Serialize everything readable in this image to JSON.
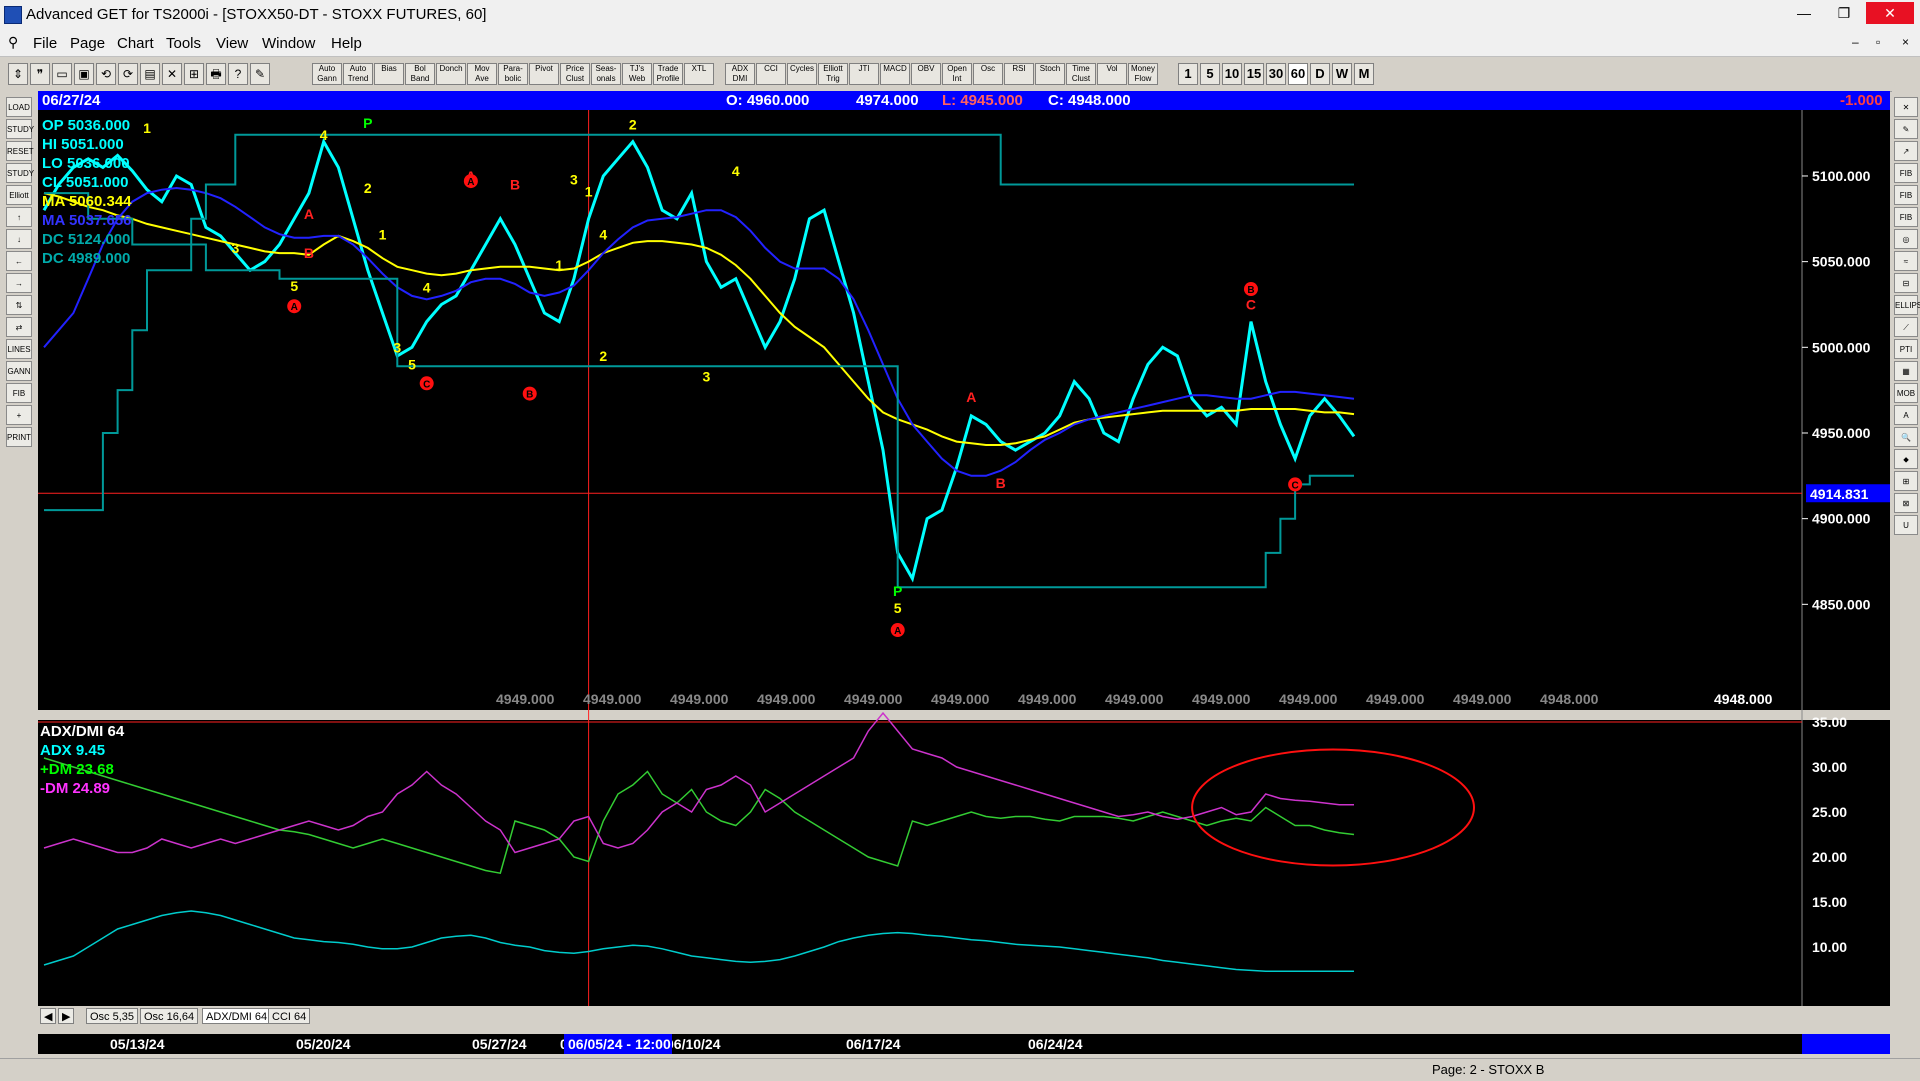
{
  "window": {
    "title": "Advanced GET for TS2000i - [STOXX50-DT - STOXX FUTURES, 60]",
    "controls": [
      "—",
      "❐",
      "✕"
    ],
    "mdi_controls": [
      "–",
      "▫",
      "×"
    ]
  },
  "menu": [
    "File",
    "Page",
    "Chart",
    "Tools",
    "View",
    "Window",
    "Help"
  ],
  "toolbar": {
    "study_buttons": [
      "Auto Gann",
      "Auto Trend",
      "Bias",
      "Bol Band",
      "Donch",
      "Mov Ave",
      "Para-bolic",
      "Pivot",
      "Price Clust",
      "Seas-onals",
      "TJ's Web",
      "Trade Profile",
      "XTL",
      "ADX DMI",
      "CCI",
      "Cycles",
      "Elliott Trig",
      "JTI",
      "MACD",
      "OBV",
      "Open Int",
      "Osc",
      "RSI",
      "Stoch",
      "Time Clust",
      "Vol",
      "Money Flow"
    ],
    "intervals": [
      "1",
      "5",
      "10",
      "15",
      "30",
      "60",
      "D",
      "W",
      "M"
    ],
    "active_interval": "60"
  },
  "left_tools": [
    "LOAD",
    "STUDY",
    "RESET",
    "STUDY",
    "Elliott",
    "↑",
    "↓",
    "←",
    "→",
    "⇅",
    "⇄",
    "LINES",
    "GANN",
    "FIB",
    "+",
    "PRINT"
  ],
  "right_tools": [
    "✕",
    "✎",
    "↗",
    "FIB RET",
    "FIB EXT",
    "FIB TIME",
    "◎",
    "≈",
    "⊟",
    "ELLIPS",
    "⟋",
    "PTI",
    "▦",
    "MOB",
    "A",
    "🔍",
    "⬥",
    "⊞",
    "⊠",
    "U"
  ],
  "info_bar": {
    "date": "06/27/24",
    "open": "O: 4960.000",
    "high": "4974.000",
    "low": "L: 4945.000",
    "close": "C: 4948.000",
    "change": "-1.000"
  },
  "price_panel": {
    "readouts": [
      {
        "label": "OP",
        "value": "5036.000",
        "color": "#00ffff"
      },
      {
        "label": "HI",
        "value": "5051.000",
        "color": "#00ffff"
      },
      {
        "label": "LO",
        "value": "5036.000",
        "color": "#00ffff"
      },
      {
        "label": "CL",
        "value": "5051.000",
        "color": "#00ffff"
      },
      {
        "label": "MA",
        "value": "5060.344",
        "color": "#ffff00"
      },
      {
        "label": "MA",
        "value": "5037.656",
        "color": "#3333ff"
      },
      {
        "label": "DC",
        "value": "5124.000",
        "color": "#00aaaa"
      },
      {
        "label": "DC",
        "value": "4989.000",
        "color": "#00aaaa"
      }
    ],
    "axis_labels": [
      "5100.000",
      "5050.000",
      "5000.000",
      "4950.000",
      "4900.000",
      "4850.000"
    ],
    "marker_price": "4914.831",
    "bottom_values": [
      "4949.000",
      "4949.000",
      "4949.000",
      "4949.000",
      "4949.000",
      "4949.000",
      "4949.000",
      "4949.000",
      "4949.000",
      "4949.000",
      "4949.000",
      "4949.000",
      "4948.000",
      "4948.000"
    ]
  },
  "oscillator_panel": {
    "title": "ADX/DMI 64",
    "readouts": [
      {
        "label": "ADX",
        "value": "9.45",
        "color": "#00ffff"
      },
      {
        "label": "+DM",
        "value": "23.68",
        "color": "#00ff00"
      },
      {
        "label": "-DM",
        "value": "24.89",
        "color": "#ff33ff"
      }
    ],
    "axis_labels": [
      "35.00",
      "30.00",
      "25.00",
      "20.00",
      "15.00",
      "10.00"
    ]
  },
  "bottom_tabs": [
    "Osc 5,35",
    "Osc 16,64",
    "ADX/DMI 64",
    "CCI 64"
  ],
  "active_tab": "ADX/DMI 64",
  "date_axis": {
    "labels": [
      "05/13/24",
      "05/20/24",
      "05/27/24",
      "0(",
      "06/10/24",
      "06/17/24",
      "06/24/24"
    ],
    "cursor_label": "06/05/24 - 12:00"
  },
  "status": {
    "page": "Page: 2 - STOXX B"
  },
  "chart_data": {
    "type": "line",
    "title": "STOXX50-DT - STOXX FUTURES, 60",
    "ylim": [
      4800,
      5135
    ],
    "price_series": [
      {
        "name": "CL",
        "color": "#00ffff",
        "values": [
          5080,
          5095,
          5105,
          5110,
          5105,
          5112,
          5103,
          5092,
          5085,
          5100,
          5095,
          5070,
          5065,
          5055,
          5045,
          5050,
          5060,
          5075,
          5090,
          5120,
          5105,
          5075,
          5045,
          5020,
          4995,
          5000,
          5015,
          5025,
          5030,
          5045,
          5060,
          5075,
          5060,
          5040,
          5020,
          5015,
          5040,
          5075,
          5100,
          5110,
          5120,
          5105,
          5080,
          5075,
          5090,
          5050,
          5035,
          5040,
          5020,
          5000,
          5015,
          5040,
          5075,
          5080,
          5050,
          5020,
          4980,
          4940,
          4880,
          4865,
          4900,
          4905,
          4930,
          4960,
          4955,
          4945,
          4940,
          4945,
          4950,
          4960,
          4980,
          4970,
          4950,
          4945,
          4970,
          4990,
          5000,
          4995,
          4970,
          4960,
          4965,
          4955,
          5015,
          4980,
          4955,
          4935,
          4960,
          4970,
          4960,
          4948
        ]
      },
      {
        "name": "MA",
        "color": "#ffff00",
        "values": [
          5090,
          5088,
          5085,
          5082,
          5080,
          5077,
          5075,
          5072,
          5070,
          5068,
          5066,
          5064,
          5062,
          5060,
          5058,
          5056,
          5055,
          5055,
          5054,
          5060,
          5065,
          5062,
          5058,
          5052,
          5047,
          5045,
          5043,
          5042,
          5043,
          5045,
          5046,
          5047,
          5047,
          5047,
          5046,
          5045,
          5046,
          5050,
          5055,
          5058,
          5061,
          5062,
          5062,
          5061,
          5060,
          5058,
          5054,
          5048,
          5040,
          5030,
          5020,
          5012,
          5006,
          5000,
          4990,
          4980,
          4970,
          4962,
          4958,
          4955,
          4952,
          4948,
          4945,
          4944,
          4943,
          4943,
          4944,
          4946,
          4948,
          4952,
          4956,
          4958,
          4959,
          4960,
          4961,
          4962,
          4963,
          4963,
          4963,
          4963,
          4963,
          4963,
          4964,
          4964,
          4964,
          4964,
          4963,
          4962,
          4962,
          4961
        ]
      },
      {
        "name": "MA",
        "color": "#2222ff",
        "values": [
          5000,
          5010,
          5020,
          5040,
          5060,
          5075,
          5085,
          5090,
          5092,
          5093,
          5092,
          5090,
          5087,
          5082,
          5076,
          5070,
          5066,
          5064,
          5064,
          5065,
          5065,
          5060,
          5052,
          5043,
          5035,
          5030,
          5028,
          5030,
          5033,
          5038,
          5040,
          5040,
          5037,
          5032,
          5030,
          5032,
          5036,
          5045,
          5055,
          5063,
          5070,
          5074,
          5075,
          5076,
          5078,
          5080,
          5080,
          5076,
          5068,
          5058,
          5050,
          5046,
          5046,
          5046,
          5040,
          5028,
          5010,
          4990,
          4970,
          4955,
          4945,
          4935,
          4928,
          4925,
          4925,
          4928,
          4933,
          4940,
          4946,
          4950,
          4955,
          4958,
          4960,
          4962,
          4964,
          4966,
          4968,
          4970,
          4972,
          4972,
          4971,
          4970,
          4970,
          4972,
          4974,
          4974,
          4973,
          4972,
          4971,
          4970
        ]
      },
      {
        "name": "DC",
        "color": "#009999",
        "values": [
          4905,
          4905,
          4905,
          4905,
          4950,
          4975,
          5010,
          5045,
          5045,
          5045,
          5075,
          5095,
          5095,
          5124,
          5124,
          5124,
          5124,
          5124,
          5124,
          5124,
          5124,
          5124,
          5124,
          5124,
          5124,
          5124,
          5124,
          5124,
          5124,
          5124,
          5124,
          5124,
          5124,
          5124,
          5124,
          5124,
          5124,
          5124,
          5124,
          5124,
          5124,
          5124,
          5124,
          5124,
          5124,
          5124,
          5124,
          5124,
          5124,
          5124,
          5124,
          5124,
          5124,
          5124,
          5124,
          5124,
          5124,
          5124,
          5124,
          5124,
          5124,
          5124,
          5124,
          5124,
          5124,
          5095,
          5095,
          5095,
          5095,
          5095,
          5095,
          5095,
          5095,
          5095,
          5095,
          5095,
          5095,
          5095,
          5095,
          5095,
          5095,
          5095,
          5095,
          5095,
          5095,
          5095,
          5095,
          5095,
          5095,
          5095
        ]
      },
      {
        "name": "DC",
        "color": "#009999",
        "values": [
          5090,
          5090,
          5090,
          5075,
          5075,
          5075,
          5060,
          5060,
          5060,
          5060,
          5060,
          5045,
          5045,
          5045,
          5045,
          5045,
          5040,
          5040,
          5040,
          5040,
          5040,
          5040,
          5040,
          5040,
          4989,
          4989,
          4989,
          4989,
          4989,
          4989,
          4989,
          4989,
          4989,
          4989,
          4989,
          4989,
          4989,
          4989,
          4989,
          4989,
          4989,
          4989,
          4989,
          4989,
          4989,
          4989,
          4989,
          4989,
          4989,
          4989,
          4989,
          4989,
          4989,
          4989,
          4989,
          4989,
          4989,
          4989,
          4860,
          4860,
          4860,
          4860,
          4860,
          4860,
          4860,
          4860,
          4860,
          4860,
          4860,
          4860,
          4860,
          4860,
          4860,
          4860,
          4860,
          4860,
          4860,
          4860,
          4860,
          4860,
          4860,
          4860,
          4860,
          4880,
          4900,
          4920,
          4925,
          4925,
          4925,
          4925
        ]
      }
    ],
    "wave_labels": [
      {
        "text": "1",
        "i": 7,
        "y": 5125,
        "color": "#ffff00"
      },
      {
        "text": "4",
        "i": 19,
        "y": 5121,
        "color": "#ffff00"
      },
      {
        "text": "3",
        "i": 13,
        "y": 5055,
        "color": "#ffff00"
      },
      {
        "text": "A",
        "i": 18,
        "y": 5075,
        "color": "#ff2020"
      },
      {
        "text": "B",
        "i": 18,
        "y": 5052,
        "color": "#ff2020"
      },
      {
        "text": "5",
        "i": 17,
        "y": 5033,
        "color": "#ffff00"
      },
      {
        "text": "P",
        "i": 22,
        "y": 5128,
        "color": "#00ff00"
      },
      {
        "text": "2",
        "i": 22,
        "y": 5090,
        "color": "#ffff00"
      },
      {
        "text": "1",
        "i": 23,
        "y": 5063,
        "color": "#ffff00"
      },
      {
        "text": "4",
        "i": 26,
        "y": 5032,
        "color": "#ffff00"
      },
      {
        "text": "3",
        "i": 24,
        "y": 4997,
        "color": "#ffff00"
      },
      {
        "text": "5",
        "i": 25,
        "y": 4987,
        "color": "#ffff00"
      },
      {
        "text": "A",
        "i": 29,
        "y": 5097,
        "color": "#ff2020"
      },
      {
        "text": "B",
        "i": 32,
        "y": 5092,
        "color": "#ff2020"
      },
      {
        "text": "1",
        "i": 35,
        "y": 5045,
        "color": "#ffff00"
      },
      {
        "text": "3",
        "i": 36,
        "y": 5095,
        "color": "#ffff00"
      },
      {
        "text": "1",
        "i": 37,
        "y": 5088,
        "color": "#ffff00"
      },
      {
        "text": "4",
        "i": 38,
        "y": 5063,
        "color": "#ffff00"
      },
      {
        "text": "2",
        "i": 38,
        "y": 4992,
        "color": "#ffff00"
      },
      {
        "text": "2",
        "i": 40,
        "y": 5127,
        "color": "#ffff00"
      },
      {
        "text": "4",
        "i": 47,
        "y": 5100,
        "color": "#ffff00"
      },
      {
        "text": "3",
        "i": 45,
        "y": 4980,
        "color": "#ffff00"
      },
      {
        "text": "P",
        "i": 58,
        "y": 4855,
        "color": "#00ff00"
      },
      {
        "text": "5",
        "i": 58,
        "y": 4845,
        "color": "#ffff00"
      },
      {
        "text": "A",
        "i": 63,
        "y": 4968,
        "color": "#ff2020"
      },
      {
        "text": "B",
        "i": 65,
        "y": 4918,
        "color": "#ff2020"
      },
      {
        "text": "C",
        "i": 82,
        "y": 5022,
        "color": "#ff2020"
      }
    ],
    "wave_circles": [
      {
        "text": "A",
        "i": 17,
        "y": 5024
      },
      {
        "text": "C",
        "i": 26,
        "y": 4979
      },
      {
        "text": "B",
        "i": 33,
        "y": 4973
      },
      {
        "text": "A",
        "i": 29,
        "y": 5097
      },
      {
        "text": "A",
        "i": 58,
        "y": 4835
      },
      {
        "text": "B",
        "i": 82,
        "y": 5034
      },
      {
        "text": "C",
        "i": 85,
        "y": 4920
      }
    ],
    "oscillator": {
      "ylim": [
        5,
        35
      ],
      "series": [
        {
          "name": "ADX",
          "color": "#00cccc",
          "values": [
            8,
            8.5,
            9,
            10,
            11,
            12,
            12.5,
            13,
            13.5,
            13.8,
            14,
            13.8,
            13.5,
            13,
            12.5,
            12,
            11.5,
            11,
            10.8,
            10.6,
            10.5,
            10.3,
            10,
            9.8,
            9.8,
            10,
            10.5,
            11,
            11.2,
            11.3,
            11,
            10.5,
            10.2,
            10,
            9.6,
            9.4,
            9.3,
            9.5,
            9.8,
            10,
            10.2,
            10.1,
            9.8,
            9.4,
            9,
            8.8,
            8.6,
            8.4,
            8.3,
            8.4,
            8.6,
            9,
            9.5,
            10,
            10.6,
            11,
            11.3,
            11.5,
            11.6,
            11.5,
            11.3,
            11.2,
            11,
            10.8,
            10.7,
            10.5,
            10.3,
            10.2,
            10.1,
            10,
            9.8,
            9.6,
            9.4,
            9.2,
            9,
            8.8,
            8.5,
            8.3,
            8.1,
            7.9,
            7.7,
            7.5,
            7.4,
            7.3,
            7.3,
            7.3,
            7.3,
            7.3,
            7.3,
            7.3
          ]
        },
        {
          "name": "+DM",
          "color": "#33cc33",
          "values": [
            31,
            30.5,
            30,
            29.5,
            29,
            28.5,
            28,
            27.5,
            27,
            26.5,
            26,
            25.5,
            25,
            24.5,
            24,
            23.5,
            23,
            22.8,
            22.5,
            22,
            21.5,
            21,
            21.5,
            22,
            21.5,
            21,
            20.5,
            20,
            19.5,
            19,
            18.5,
            18.2,
            24,
            23.5,
            23,
            22,
            20,
            19.5,
            24,
            27,
            28,
            29.5,
            27,
            26,
            27.5,
            25,
            24,
            23.5,
            25,
            27.5,
            26.5,
            25,
            24,
            23,
            22,
            21,
            20,
            19.5,
            19,
            24,
            23.5,
            24,
            24.5,
            25,
            24.5,
            24.3,
            24.5,
            24.5,
            24.2,
            24,
            24.5,
            24.5,
            24.5,
            24.3,
            24,
            24.5,
            25,
            24.5,
            24,
            23.5,
            24,
            24.3,
            24,
            25.5,
            24.5,
            23.5,
            23.5,
            23,
            22.7,
            22.5
          ]
        },
        {
          "name": "-DM",
          "color": "#cc33cc",
          "values": [
            21,
            21.5,
            22,
            21.5,
            21,
            20.5,
            20.5,
            21,
            22,
            21.5,
            21,
            21.5,
            22,
            21.5,
            22,
            22.5,
            23,
            23.5,
            24,
            23.5,
            23,
            23.5,
            24.5,
            25,
            27,
            28,
            29.5,
            28,
            27,
            25.5,
            24,
            23,
            20.5,
            21,
            21.5,
            22,
            24,
            24.5,
            21.5,
            21,
            21.5,
            23,
            25,
            26,
            25,
            27.5,
            28,
            29,
            28,
            25,
            26,
            27,
            28,
            29,
            30,
            31,
            34,
            36,
            34,
            32,
            31.5,
            31,
            30,
            29.5,
            29,
            28.5,
            28,
            27.5,
            27,
            26.5,
            26,
            25.5,
            25,
            24.5,
            24.7,
            25,
            24.5,
            24.2,
            24.5,
            25,
            25.5,
            24.7,
            25,
            27,
            26.5,
            26.3,
            26.2,
            26,
            25.8,
            25.8
          ]
        }
      ],
      "annotation": "ellipse"
    }
  }
}
